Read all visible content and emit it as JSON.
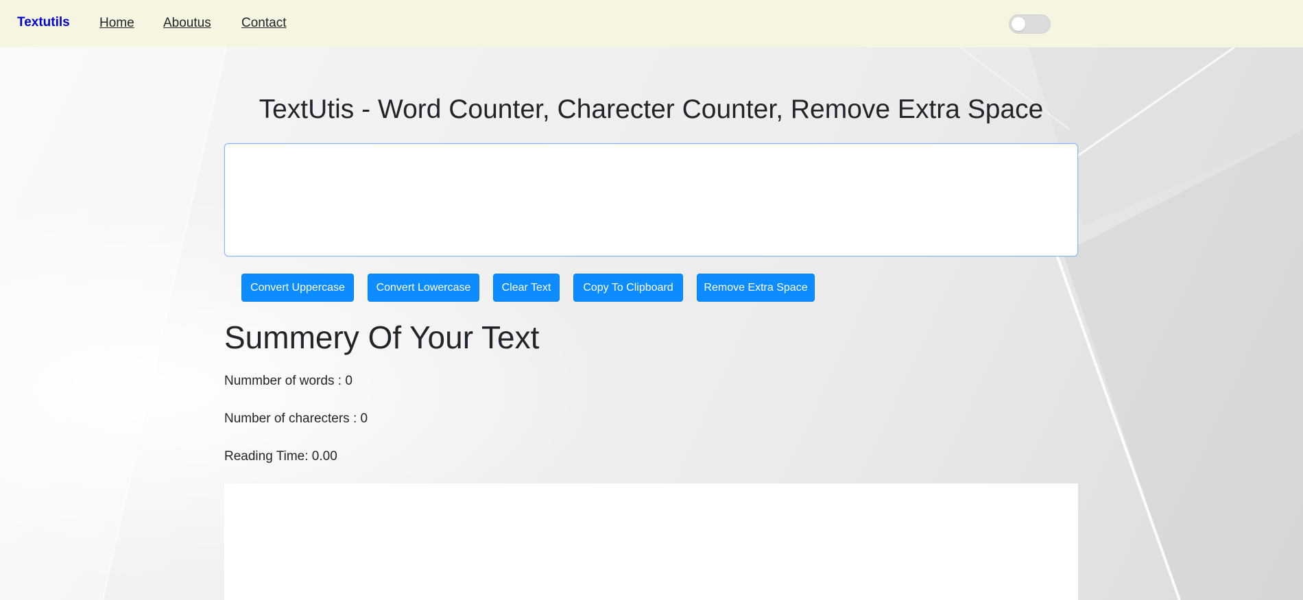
{
  "navbar": {
    "brand": "Textutils",
    "links": [
      "Home",
      "Aboutus",
      "Contact"
    ],
    "dark_mode_toggle": {
      "checked": false
    }
  },
  "main": {
    "title": "TextUtis - Word Counter, Charecter Counter, Remove Extra Space",
    "textarea_value": "",
    "buttons": [
      "Convert Uppercase",
      "Convert Lowercase",
      "Clear Text",
      "Copy To Clipboard",
      "Remove Extra Space"
    ]
  },
  "summary": {
    "heading": "Summery Of Your Text",
    "words": "Nummber of words : 0",
    "characters": "Number of charecters : 0",
    "reading_time": "Reading Time: 0.00"
  },
  "colors": {
    "navbar_bg": "#f5f5e1",
    "brand": "#0000cc",
    "button_primary": "#0d8cff"
  }
}
